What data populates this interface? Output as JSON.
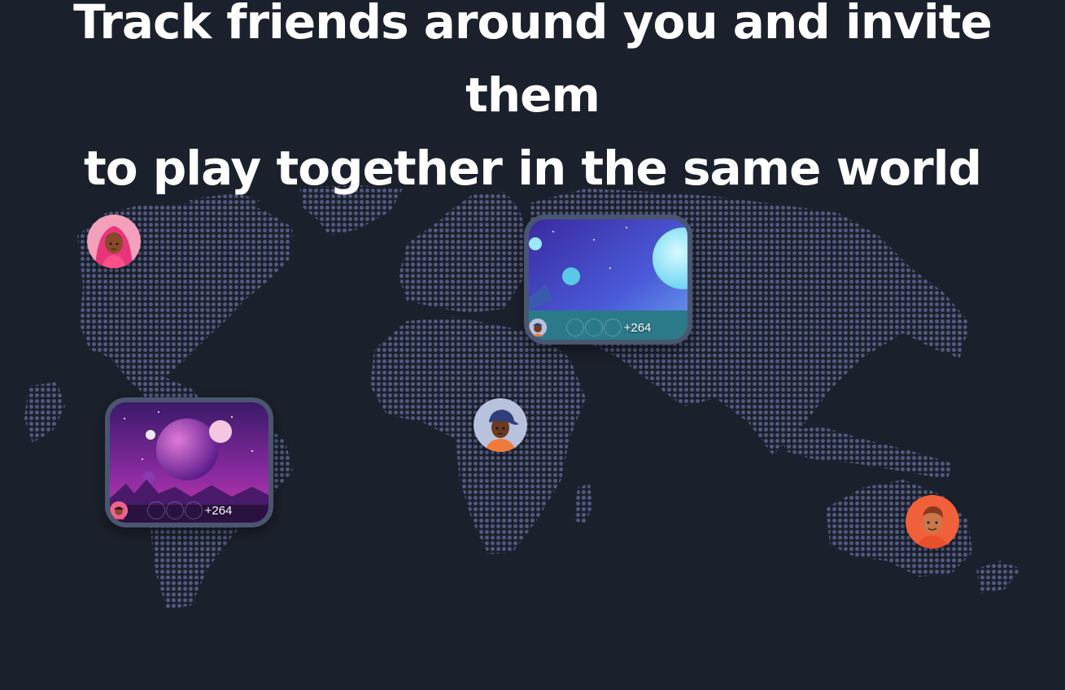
{
  "headline": {
    "line1": "Track friends around you and invite them",
    "line2": "to play together in the same world"
  },
  "colors": {
    "background": "#1b212c",
    "map_dot": "#545a82",
    "card_frame": "#4a5570",
    "text": "#ffffff"
  },
  "avatars": [
    {
      "name": "avatar-girl-pink-hood",
      "bg": "#f0628e"
    },
    {
      "name": "avatar-boy-blue-cap",
      "bg": "#b9c2dc"
    },
    {
      "name": "avatar-boy-orange",
      "bg": "#f0603a"
    }
  ],
  "worlds": [
    {
      "name": "purple-planet-world",
      "player_count": "+264",
      "players": [
        "cap-boy",
        "orange-boy",
        "pink-girl"
      ]
    },
    {
      "name": "blue-space-world",
      "player_count": "+264",
      "players": [
        "orange-boy",
        "pink-girl",
        "cap-boy"
      ]
    }
  ]
}
